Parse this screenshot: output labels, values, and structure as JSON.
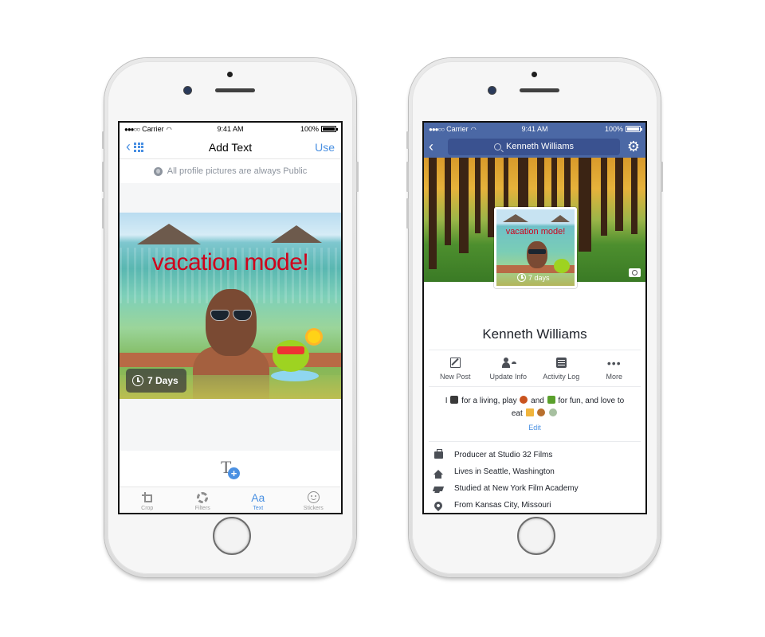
{
  "left_phone": {
    "status_bar": {
      "signal": "●●●○○",
      "carrier": "Carrier",
      "time": "9:41 AM",
      "battery": "100%"
    },
    "nav": {
      "back_icon": "chevron-left-icon",
      "grid_icon": "grid-icon",
      "title": "Add Text",
      "action": "Use"
    },
    "privacy_notice": {
      "icon": "globe-icon",
      "text": "All profile pictures are always Public"
    },
    "photo": {
      "caption": "vacation mode!",
      "caption_color": "#d0021b",
      "timer_label": "7 Days",
      "timer_icon": "clock-icon"
    },
    "add_text_button": {
      "letter": "T",
      "plus": "+"
    },
    "tabs": [
      {
        "label": "Crop",
        "icon": "crop-icon",
        "active": false
      },
      {
        "label": "Filters",
        "icon": "aperture-icon",
        "active": false
      },
      {
        "label": "Text",
        "icon_text": "Aa",
        "icon": "text-icon",
        "active": true
      },
      {
        "label": "Stickers",
        "icon": "smiley-icon",
        "active": false
      }
    ],
    "accent": "#4a90e2"
  },
  "right_phone": {
    "status_bar": {
      "signal": "●●●○○",
      "carrier": "Carrier",
      "time": "9:41 AM",
      "battery": "100%"
    },
    "nav": {
      "back_icon": "chevron-left-icon",
      "search_value": "Kenneth Williams",
      "settings_icon": "gear-icon"
    },
    "profile": {
      "name": "Kenneth Williams",
      "pic_caption": "vacation mode!",
      "pic_timer": "7 days"
    },
    "actions": [
      {
        "label": "New Post",
        "icon": "compose-icon"
      },
      {
        "label": "Update Info",
        "icon": "person-list-icon"
      },
      {
        "label": "Activity Log",
        "icon": "list-icon"
      },
      {
        "label": "More",
        "icon": "more-dots-icon"
      }
    ],
    "bio": {
      "part1": "I",
      "part2": "for a living, play",
      "part3": "and",
      "part4": "for fun, and love to eat",
      "edit_label": "Edit"
    },
    "info": [
      {
        "icon": "briefcase-icon",
        "text": "Producer at Studio 32 Films"
      },
      {
        "icon": "home-icon",
        "text": "Lives in Seattle, Washington"
      },
      {
        "icon": "graduation-cap-icon",
        "text": "Studied at New York Film Academy"
      },
      {
        "icon": "location-pin-icon",
        "text": "From Kansas City, Missouri"
      }
    ],
    "brand_color": "#4b68a5"
  }
}
